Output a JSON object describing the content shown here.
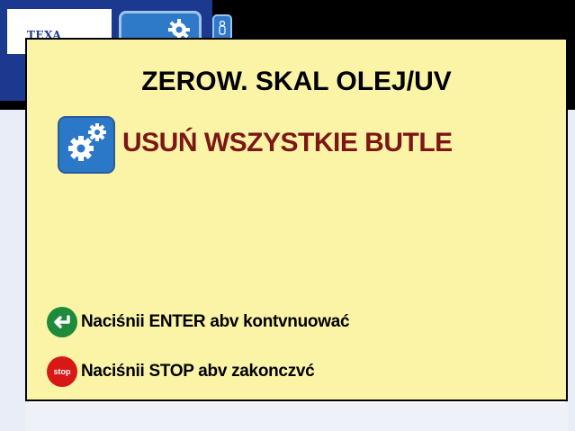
{
  "header": {
    "logo_text": "TEXA",
    "tabs": [
      {
        "icon": "gear-icon"
      },
      {
        "icon": "person-icon"
      }
    ]
  },
  "dialog": {
    "title": "ZEROW. SKAL OLEJ/UV",
    "message": {
      "icon": "gears-icon",
      "text": "USUŃ WSZYSTKIE BUTLE"
    },
    "actions": [
      {
        "icon": "enter-icon",
        "icon_color": "#1e8b3a",
        "label": "Naciśnii ENTER abv kontvnuować"
      },
      {
        "icon": "stop-icon",
        "icon_color": "#d81717",
        "icon_text": "stop",
        "label": "Naciśnii STOP abv zakonczvć"
      }
    ]
  },
  "colors": {
    "dialog_bg": "#fbf4a7",
    "message_text": "#7b1717",
    "header_blue": "#1b3a8f",
    "tab_blue": "#2f79c9"
  }
}
